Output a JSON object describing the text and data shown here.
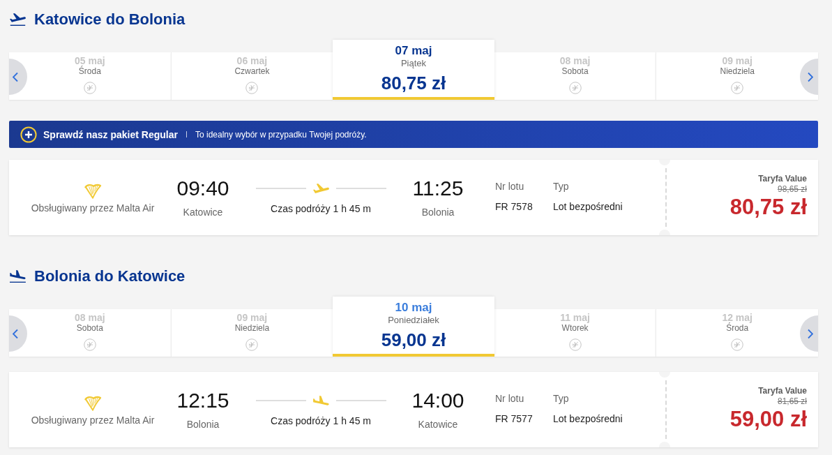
{
  "journeys": [
    {
      "kind": "outbound",
      "title": "Katowice do Bolonia",
      "dates": [
        {
          "date": "05 maj",
          "weekday": "Środa",
          "selected": false,
          "hovered": false,
          "available": false
        },
        {
          "date": "06 maj",
          "weekday": "Czwartek",
          "selected": false,
          "hovered": false,
          "available": false
        },
        {
          "date": "07 maj",
          "weekday": "Piątek",
          "price": "80,75 zł",
          "selected": true,
          "hovered": false,
          "available": true
        },
        {
          "date": "08 maj",
          "weekday": "Sobota",
          "selected": false,
          "hovered": false,
          "available": false
        },
        {
          "date": "09 maj",
          "weekday": "Niedziela",
          "selected": false,
          "hovered": false,
          "available": false
        }
      ],
      "banner": {
        "title": "Sprawdź nasz pakiet Regular",
        "text": "To idealny wybór w przypadku Twojej podróży."
      },
      "flight": {
        "operator": "Obsługiwany przez Malta Air",
        "departure_time": "09:40",
        "departure_city": "Katowice",
        "duration": "Czas podróży 1 h 45 m",
        "arrival_time": "11:25",
        "arrival_city": "Bolonia",
        "flight_number_label": "Nr lotu",
        "flight_number": "FR 7578",
        "type_label": "Typ",
        "type": "Lot bezpośredni",
        "fare_name": "Taryfa Value",
        "old_price": "98,65 zł",
        "price": "80,75 zł"
      }
    },
    {
      "kind": "inbound",
      "title": "Bolonia do Katowice",
      "dates": [
        {
          "date": "08 maj",
          "weekday": "Sobota",
          "selected": false,
          "hovered": false,
          "available": false
        },
        {
          "date": "09 maj",
          "weekday": "Niedziela",
          "selected": false,
          "hovered": false,
          "available": false
        },
        {
          "date": "10 maj",
          "weekday": "Poniedziałek",
          "price": "59,00 zł",
          "selected": true,
          "hovered": true,
          "available": true
        },
        {
          "date": "11 maj",
          "weekday": "Wtorek",
          "selected": false,
          "hovered": false,
          "available": false
        },
        {
          "date": "12 maj",
          "weekday": "Środa",
          "selected": false,
          "hovered": false,
          "available": false
        }
      ],
      "flight": {
        "operator": "Obsługiwany przez Malta Air",
        "departure_time": "12:15",
        "departure_city": "Bolonia",
        "duration": "Czas podróży 1 h 45 m",
        "arrival_time": "14:00",
        "arrival_city": "Katowice",
        "flight_number_label": "Nr lotu",
        "flight_number": "FR 7577",
        "type_label": "Typ",
        "type": "Lot bezpośredni",
        "fare_name": "Taryfa Value",
        "old_price": "81,65 zł",
        "price": "59,00 zł"
      }
    }
  ]
}
